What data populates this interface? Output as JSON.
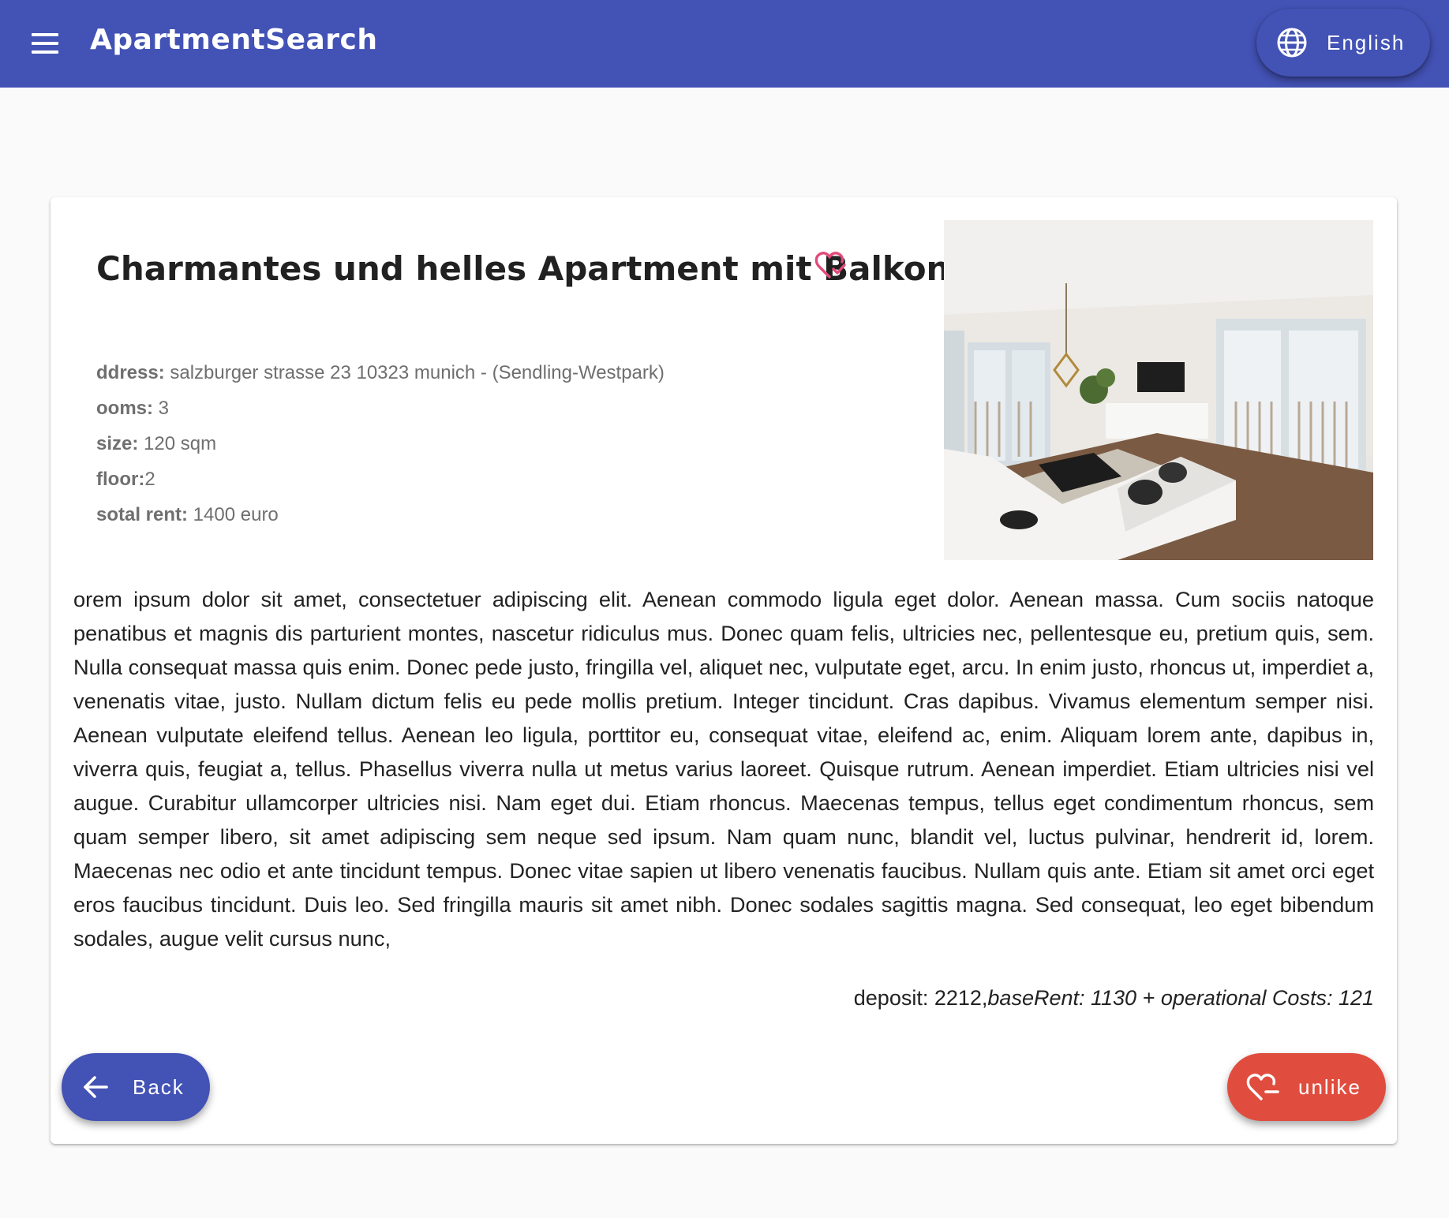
{
  "header": {
    "app_title": "ApartmentSearch",
    "language_label": "English",
    "icons": {
      "menu": "menu-icon",
      "language": "globe-icon"
    },
    "color": "#4352b5"
  },
  "listing": {
    "title": "Charmantes und helles Apartment mit Balkon",
    "liked": true,
    "details": [
      {
        "label": "ddress:",
        "value": " salzburger strasse 23 10323 munich - (Sendling-Westpark)"
      },
      {
        "label": "ooms:",
        "value": " 3"
      },
      {
        "label": "size:",
        "value": " 120 sqm"
      },
      {
        "label": "floor:",
        "value": "2"
      },
      {
        "label": "sotal rent:",
        "value": " 1400 euro"
      }
    ],
    "photo": "living-room-photo",
    "description": "orem ipsum dolor sit amet, consectetuer adipiscing elit. Aenean commodo ligula eget dolor. Aenean massa. Cum sociis natoque penatibus et magnis dis parturient montes, nascetur ridiculus mus. Donec quam felis, ultricies nec, pellentesque eu, pretium quis, sem. Nulla consequat massa quis enim. Donec pede justo, fringilla vel, aliquet nec, vulputate eget, arcu. In enim justo, rhoncus ut, imperdiet a, venenatis vitae, justo. Nullam dictum felis eu pede mollis pretium. Integer tincidunt. Cras dapibus. Vivamus elementum semper nisi. Aenean vulputate eleifend tellus. Aenean leo ligula, porttitor eu, consequat vitae, eleifend ac, enim. Aliquam lorem ante, dapibus in, viverra quis, feugiat a, tellus. Phasellus viverra nulla ut metus varius laoreet. Quisque rutrum. Aenean imperdiet. Etiam ultricies nisi vel augue. Curabitur ullamcorper ultricies nisi. Nam eget dui. Etiam rhoncus. Maecenas tempus, tellus eget condimentum rhoncus, sem quam semper libero, sit amet adipiscing sem neque sed ipsum. Nam quam nunc, blandit vel, luctus pulvinar, hendrerit id, lorem. Maecenas nec odio et ante tincidunt tempus. Donec vitae sapien ut libero venenatis faucibus. Nullam quis ante. Etiam sit amet orci eget eros faucibus tincidunt. Duis leo. Sed fringilla mauris sit amet nibh. Donec sodales sagittis magna. Sed consequat, leo eget bibendum sodales, augue velit cursus nunc,",
    "costs": {
      "deposit": "deposit: 2212,",
      "breakdown": "baseRent: 1130 + operational Costs: 121"
    }
  },
  "actions": {
    "back_label": "Back",
    "unlike_label": "unlike",
    "back_color": "#4352b5",
    "unlike_color": "#e04d3e",
    "heart_color": "#e24a7a"
  }
}
